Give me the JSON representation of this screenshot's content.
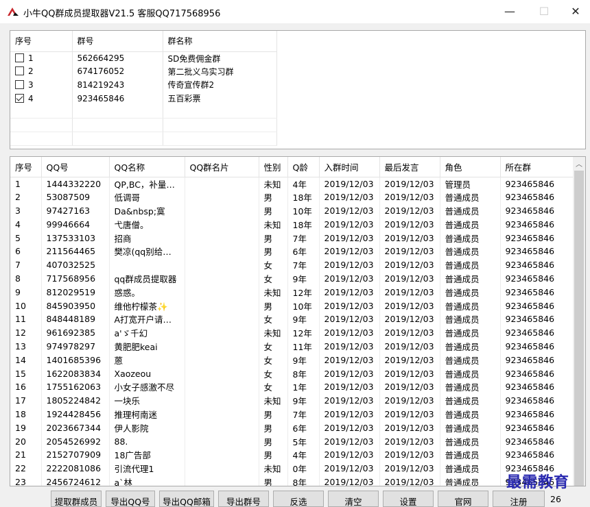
{
  "window": {
    "title": "小牛QQ群成员提取器V21.5   客服QQ717568956",
    "minimize": "—",
    "maximize": "☐",
    "close": "✕"
  },
  "groups": {
    "headers": [
      "序号",
      "群号",
      "群名称"
    ],
    "rows": [
      {
        "idx": "1",
        "num": "562664295",
        "name": "SD免费佣金群",
        "checked": false
      },
      {
        "idx": "2",
        "num": "674176052",
        "name": "第二批义乌实习群",
        "checked": false
      },
      {
        "idx": "3",
        "num": "814219243",
        "name": "传奇宣传群2",
        "checked": false
      },
      {
        "idx": "4",
        "num": "923465846",
        "name": "五百彩票",
        "checked": true
      }
    ]
  },
  "members": {
    "headers": [
      "序号",
      "QQ号",
      "QQ名称",
      "QQ群名片",
      "性别",
      "Q龄",
      "入群时间",
      "最后发言",
      "角色",
      "所在群"
    ],
    "rows": [
      [
        "1",
        "1444332220",
        "QP,BC，补量…",
        "",
        "未知",
        "4年",
        "2019/12/03",
        "2019/12/03",
        "管理员",
        "923465846"
      ],
      [
        "2",
        "53087509",
        "低调哥",
        "",
        "男",
        "18年",
        "2019/12/03",
        "2019/12/03",
        "普通成员",
        "923465846"
      ],
      [
        "3",
        "97427163",
        "Da&nbsp;寞",
        "",
        "男",
        "10年",
        "2019/12/03",
        "2019/12/03",
        "普通成员",
        "923465846"
      ],
      [
        "4",
        "99946664",
        "弋唐僧。",
        "",
        "未知",
        "18年",
        "2019/12/03",
        "2019/12/03",
        "普通成员",
        "923465846"
      ],
      [
        "5",
        "137533103",
        "招商",
        "",
        "男",
        "7年",
        "2019/12/03",
        "2019/12/03",
        "普通成员",
        "923465846"
      ],
      [
        "6",
        "211564465",
        "樊凉(qq别给…",
        "",
        "男",
        "6年",
        "2019/12/03",
        "2019/12/03",
        "普通成员",
        "923465846"
      ],
      [
        "7",
        "407032525",
        "",
        "",
        "女",
        "7年",
        "2019/12/03",
        "2019/12/03",
        "普通成员",
        "923465846"
      ],
      [
        "8",
        "717568956",
        "qq群成员提取器",
        "",
        "女",
        "9年",
        "2019/12/03",
        "2019/12/03",
        "普通成员",
        "923465846"
      ],
      [
        "9",
        "812029519",
        "惑惑。",
        "",
        "未知",
        "12年",
        "2019/12/03",
        "2019/12/03",
        "普通成员",
        "923465846"
      ],
      [
        "10",
        "845903950",
        "维他柠檬茶✨",
        "",
        "男",
        "10年",
        "2019/12/03",
        "2019/12/03",
        "普通成员",
        "923465846"
      ],
      [
        "11",
        "848448189",
        "A打宽开户请…",
        "",
        "女",
        "9年",
        "2019/12/03",
        "2019/12/03",
        "普通成员",
        "923465846"
      ],
      [
        "12",
        "961692385",
        "a'ゞ千幻",
        "",
        "未知",
        "12年",
        "2019/12/03",
        "2019/12/03",
        "普通成员",
        "923465846"
      ],
      [
        "13",
        "974978297",
        "黄肥肥keai",
        "",
        "女",
        "11年",
        "2019/12/03",
        "2019/12/03",
        "普通成员",
        "923465846"
      ],
      [
        "14",
        "1401685396",
        "蒽",
        "",
        "女",
        "9年",
        "2019/12/03",
        "2019/12/03",
        "普通成员",
        "923465846"
      ],
      [
        "15",
        "1622083834",
        "Xaozeou",
        "",
        "女",
        "8年",
        "2019/12/03",
        "2019/12/03",
        "普通成员",
        "923465846"
      ],
      [
        "16",
        "1755162063",
        "小女子感激不尽",
        "",
        "女",
        "1年",
        "2019/12/03",
        "2019/12/03",
        "普通成员",
        "923465846"
      ],
      [
        "17",
        "1805224842",
        "一块乐",
        "",
        "未知",
        "9年",
        "2019/12/03",
        "2019/12/03",
        "普通成员",
        "923465846"
      ],
      [
        "18",
        "1924428456",
        "推理柯南迷",
        "",
        "男",
        "7年",
        "2019/12/03",
        "2019/12/03",
        "普通成员",
        "923465846"
      ],
      [
        "19",
        "2023667344",
        "伊人影院",
        "",
        "男",
        "6年",
        "2019/12/03",
        "2019/12/03",
        "普通成员",
        "923465846"
      ],
      [
        "20",
        "2054526992",
        "88.",
        "",
        "男",
        "5年",
        "2019/12/03",
        "2019/12/03",
        "普通成员",
        "923465846"
      ],
      [
        "21",
        "2152707909",
        "18广告部",
        "",
        "男",
        "4年",
        "2019/12/03",
        "2019/12/03",
        "普通成员",
        "923465846"
      ],
      [
        "22",
        "2222081086",
        "引流代理1",
        "",
        "未知",
        "0年",
        "2019/12/03",
        "2019/12/03",
        "普通成员",
        "923465846"
      ],
      [
        "23",
        "2456724612",
        "a`林",
        "",
        "男",
        "8年",
        "2019/12/03",
        "2019/12/03",
        "普通成员",
        "923465846"
      ]
    ]
  },
  "buttons": {
    "extract": "提取群成员",
    "export_qq": "导出QQ号",
    "export_mail": "导出QQ邮箱",
    "export_group": "导出群号",
    "invert": "反选",
    "clear": "清空",
    "settings": "设置",
    "website": "官网",
    "register": "注册"
  },
  "status": {
    "count": "26"
  },
  "watermark": "最需教育",
  "colors": {
    "accent_logo": "#c8282d",
    "watermark": "#2a2ab0"
  }
}
